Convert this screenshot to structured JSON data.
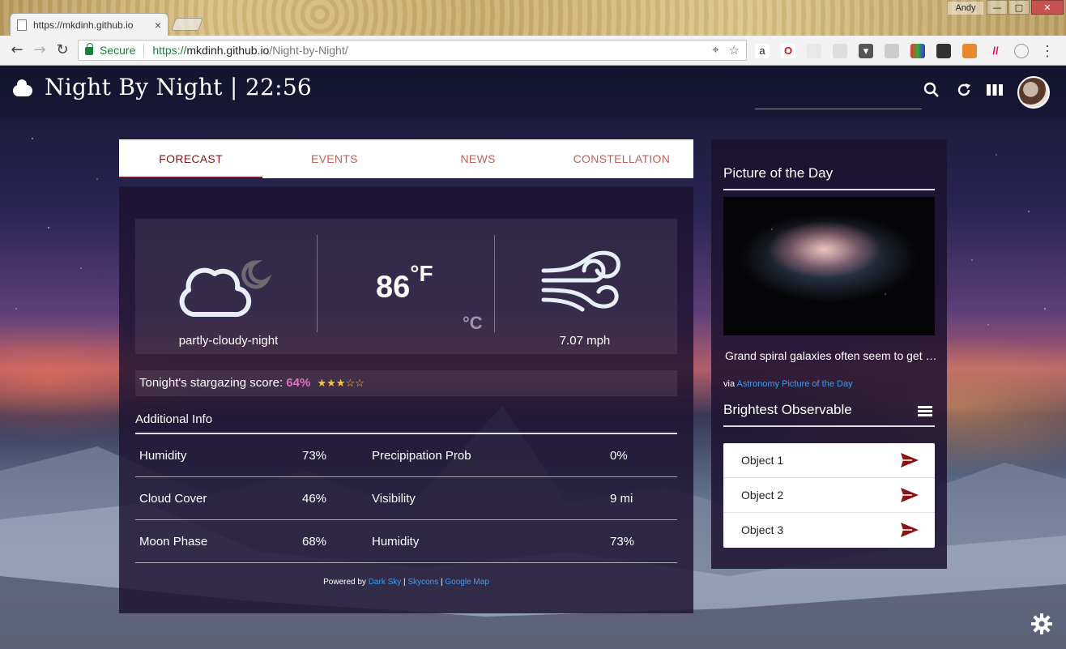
{
  "browser": {
    "tab_title": "https://mkdinh.github.io",
    "tab_close": "×",
    "user_name": "Andy",
    "window_min": "—",
    "window_max": "□",
    "window_close": "✕",
    "secure_label": "Secure",
    "url_scheme": "https://",
    "url_host": "mkdinh.github.io",
    "url_path": "/Night-by-Night/"
  },
  "app": {
    "title": "Night By Night | 22:56",
    "search_placeholder": ""
  },
  "tabs": [
    {
      "label": "FORECAST",
      "active": true
    },
    {
      "label": "EVENTS",
      "active": false
    },
    {
      "label": "NEWS",
      "active": false
    },
    {
      "label": "CONSTELLATION",
      "active": false
    }
  ],
  "weather": {
    "condition": "partly-cloudy-night",
    "temperature": "86",
    "unit_f": "°F",
    "unit_c": "°C",
    "wind": "7.07 mph"
  },
  "stargazing": {
    "label": "Tonight's stargazing score:",
    "score": "64%",
    "stars": "★★★☆☆",
    "rating": 3,
    "rating_max": 5
  },
  "additional_info": {
    "title": "Additional Info",
    "rows": [
      {
        "label1": "Humidity",
        "value1": "73%",
        "label2": "Precipipation Prob",
        "value2": "0%"
      },
      {
        "label1": "Cloud Cover",
        "value1": "46%",
        "label2": "Visibility",
        "value2": "9 mi"
      },
      {
        "label1": "Moon Phase",
        "value1": "68%",
        "label2": "Humidity",
        "value2": "73%"
      }
    ]
  },
  "footer": {
    "powered_by": "Powered by",
    "link1": "Dark Sky",
    "link2": "Skycons",
    "link3": "Google Map",
    "sep": "|"
  },
  "sidebar": {
    "potd_title": "Picture of the Day",
    "potd_caption": "Grand spiral galaxies often seem to get all the glory",
    "via_label": "via",
    "via_link": "Astronomy Picture of the Day",
    "brightest_title": "Brightest Observable",
    "objects": [
      "Object 1",
      "Object 2",
      "Object 3"
    ]
  },
  "colors": {
    "accent": "#7b1a18",
    "tab_inactive": "#c0605a",
    "score": "#e06fc4",
    "star": "#f7c531",
    "link": "#3d9cf0"
  }
}
